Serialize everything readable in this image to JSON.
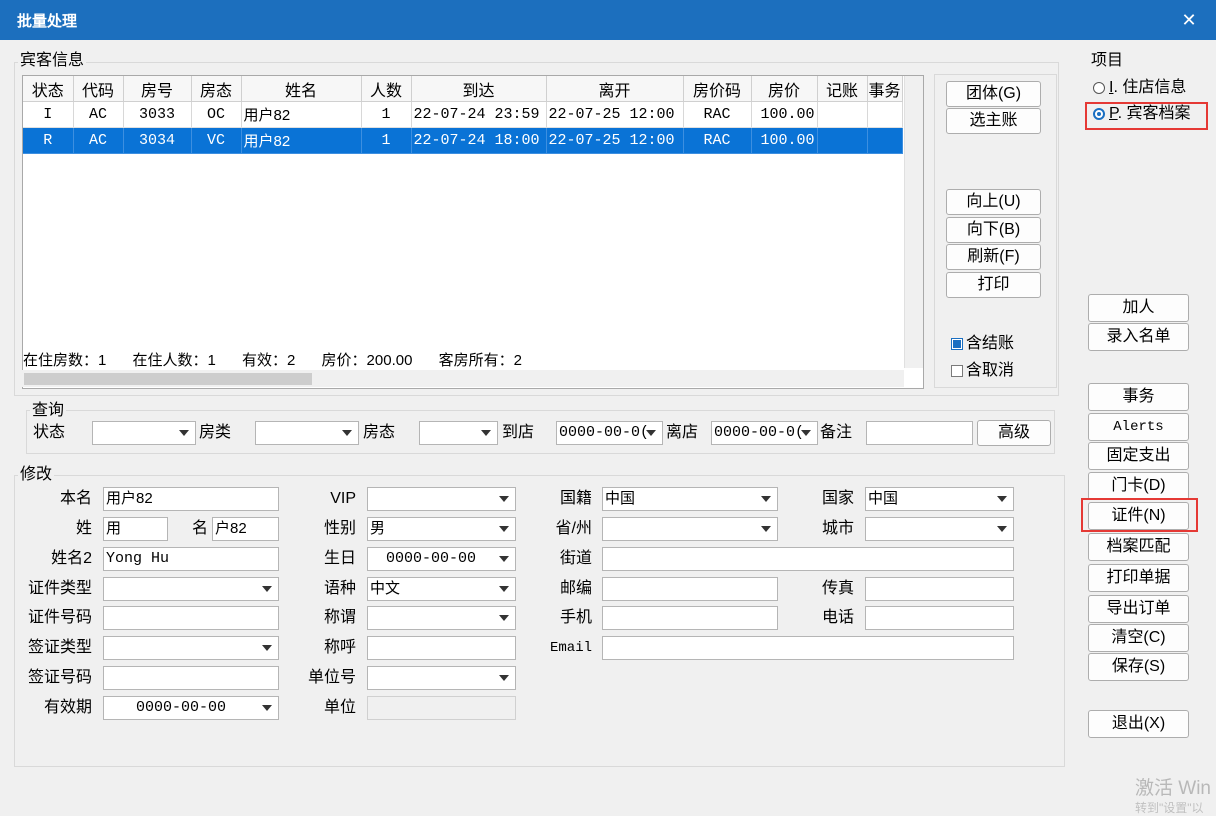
{
  "window": {
    "title": "批量处理",
    "close_glyph": "✕"
  },
  "guest_info": {
    "group_label": "宾客信息",
    "columns": [
      "状态",
      "代码",
      "房号",
      "房态",
      "姓名",
      "人数",
      "到达",
      "离开",
      "房价码",
      "房价",
      "记账",
      "事务"
    ],
    "rows": [
      {
        "status": "I",
        "code": "AC",
        "room": "3033",
        "room_state": "OC",
        "name": "用户82",
        "count": "1",
        "arrive": "22-07-24 23:59",
        "depart": "22-07-25 12:00",
        "rate_code": "RAC",
        "rate": "100.00",
        "ledger": "",
        "task": ""
      },
      {
        "status": "R",
        "code": "AC",
        "room": "3034",
        "room_state": "VC",
        "name": "用户82",
        "count": "1",
        "arrive": "22-07-24 18:00",
        "depart": "22-07-25 12:00",
        "rate_code": "RAC",
        "rate": "100.00",
        "ledger": "",
        "task": ""
      }
    ],
    "selected_row": 1,
    "summary": {
      "rooms": "在住房数：1",
      "people": "在住人数：1",
      "valid": "有效：2",
      "price": "房价：200.00",
      "owner": "客房所有：2"
    }
  },
  "grid_buttons": {
    "group": "团体(G)",
    "group_key": "G",
    "main_account": "选主账",
    "up": "向上(U)",
    "up_key": "U",
    "down": "向下(B)",
    "down_key": "B",
    "refresh": "刷新(F)",
    "refresh_key": "F",
    "print": "打印"
  },
  "checks": {
    "include_settled": "含结账",
    "include_settled_checked": true,
    "include_cancel": "含取消",
    "include_cancel_checked": false
  },
  "query": {
    "group_label": "查询",
    "status_label": "状态",
    "status_value": "",
    "room_type_label": "房类",
    "room_type_value": "",
    "room_state_label": "房态",
    "room_state_value": "",
    "arrive_label": "到店",
    "arrive_value": "0000-00-0(",
    "depart_label": "离店",
    "depart_value": "0000-00-0(",
    "note_label": "备注",
    "note_value": "",
    "advanced_button": "高级"
  },
  "edit": {
    "group_label": "修改",
    "fullname_label": "本名",
    "fullname_value": "用户82",
    "surname_label": "姓",
    "surname_value": "用",
    "given_label": "名",
    "given_value": "户82",
    "name2_label": "姓名2",
    "name2_value": "Yong Hu",
    "id_type_label": "证件类型",
    "id_type_value": "",
    "id_no_label": "证件号码",
    "id_no_value": "",
    "visa_type_label": "签证类型",
    "visa_type_value": "",
    "visa_no_label": "签证号码",
    "visa_no_value": "",
    "expiry_label": "有效期",
    "expiry_value": "0000-00-00",
    "vip_label": "VIP",
    "vip_value": "",
    "gender_label": "性别",
    "gender_value": "男",
    "birthday_label": "生日",
    "birthday_value": "0000-00-00",
    "language_label": "语种",
    "language_value": "中文",
    "title_label": "称谓",
    "title_value": "",
    "salutation_label": "称呼",
    "salutation_value": "",
    "unit_no_label": "单位号",
    "unit_no_value": "",
    "unit_label": "单位",
    "unit_value": "",
    "nationality_label": "国籍",
    "nationality_value": "中国",
    "province_label": "省/州",
    "province_value": "",
    "street_label": "街道",
    "street_value": "",
    "zip_label": "邮编",
    "zip_value": "",
    "mobile_label": "手机",
    "mobile_value": "",
    "email_label": "Email",
    "email_value": "",
    "country_label": "国家",
    "country_value": "中国",
    "city_label": "城市",
    "city_value": "",
    "fax_label": "传真",
    "fax_value": "",
    "phone_label": "电话",
    "phone_value": ""
  },
  "project": {
    "group_label": "项目",
    "option_i": "I. 住店信息",
    "option_i_key": "I",
    "option_i_rest": ". 住店信息",
    "option_p": "P. 宾客档案",
    "option_p_key": "P",
    "option_p_rest": ". 宾客档案",
    "selected": "P"
  },
  "side_buttons": {
    "add_person": "加人",
    "enter_list": "录入名单",
    "task": "事务",
    "alerts": "Alerts",
    "fixed_expense": "固定支出",
    "door_card": "门卡(D)",
    "door_card_key": "D",
    "id_doc": "证件(N)",
    "id_doc_key": "N",
    "profile_match": "档案匹配",
    "print_doc": "打印单据",
    "export_order": "导出订单",
    "clear": "清空(C)",
    "clear_key": "C",
    "save": "保存(S)",
    "save_key": "S",
    "exit": "退出(X)",
    "exit_key": "X"
  },
  "watermark": {
    "line1": "激活 Win",
    "line2": "转到\"设置\"以"
  },
  "colors": {
    "titlebar": "#1c6fbe",
    "selection": "#0a73d6",
    "highlight_box": "#e53935"
  }
}
